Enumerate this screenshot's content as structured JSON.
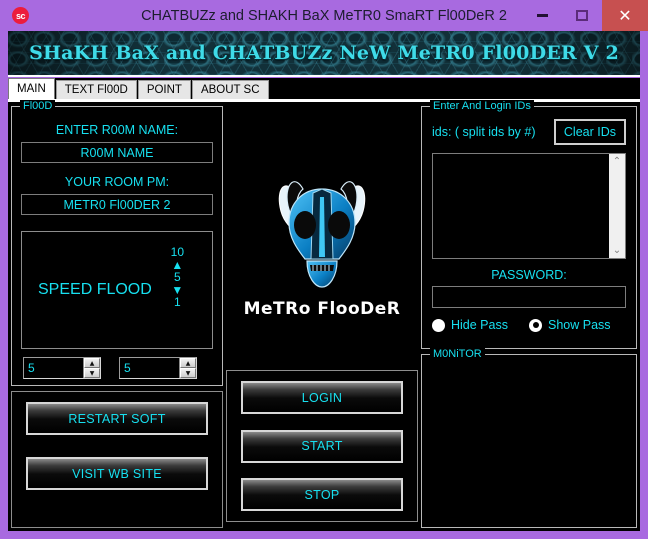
{
  "window": {
    "title": "CHATBUZz and SHAKH BaX MeTR0 SmaRT Fl00DeR 2",
    "app_icon_label": "sc",
    "minimize_label": "–",
    "maximize_label": "□",
    "close_label": "✕",
    "frame_color": "#a86ae0",
    "accent_color": "#17e0f0",
    "close_color": "#c75050"
  },
  "banner": {
    "text": "SHaKH BaX and CHATBUZz NeW MeTR0 Fl00DER V 2"
  },
  "tabs": [
    {
      "label": "MAIN",
      "active": true
    },
    {
      "label": "TEXT Fl00D",
      "active": false
    },
    {
      "label": "POINT",
      "active": false
    },
    {
      "label": "ABOUT SC",
      "active": false
    }
  ],
  "flood_group": {
    "legend": "Fl00D",
    "room_name_label": "ENTER R00M NAME:",
    "room_name_value": "R00M NAME",
    "room_pm_label": "YOUR ROOM PM:",
    "room_pm_value": "METR0 Fl00DER 2",
    "speed_label": "SPEED FLOOD",
    "trackbar": {
      "max": "10",
      "up_arrow": "▲",
      "value": "5",
      "down_arrow": "▼",
      "min": "1"
    },
    "spinner_left_value": "5",
    "spinner_right_value": "5",
    "spin_up": "▲",
    "spin_down": "▼"
  },
  "left_buttons": {
    "restart": "RESTART SOFT",
    "visit": "VISIT WB SITE"
  },
  "logo": {
    "caption": "MeTRo FlooDeR"
  },
  "center_buttons": {
    "login": "LOGIN",
    "start": "START",
    "stop": "STOP"
  },
  "ids_group": {
    "legend": "Enter And Login IDs",
    "hint": "ids: ( split ids by #)",
    "clear_button": "Clear IDs",
    "ids_value": "",
    "scroll_up": "⌃",
    "scroll_down": "⌄",
    "password_label": "PASSWORD:",
    "password_value": "",
    "hide_pass_label": "Hide Pass",
    "show_pass_label": "Show Pass"
  },
  "monitor_group": {
    "legend": "M0NiTOR",
    "content": ""
  }
}
